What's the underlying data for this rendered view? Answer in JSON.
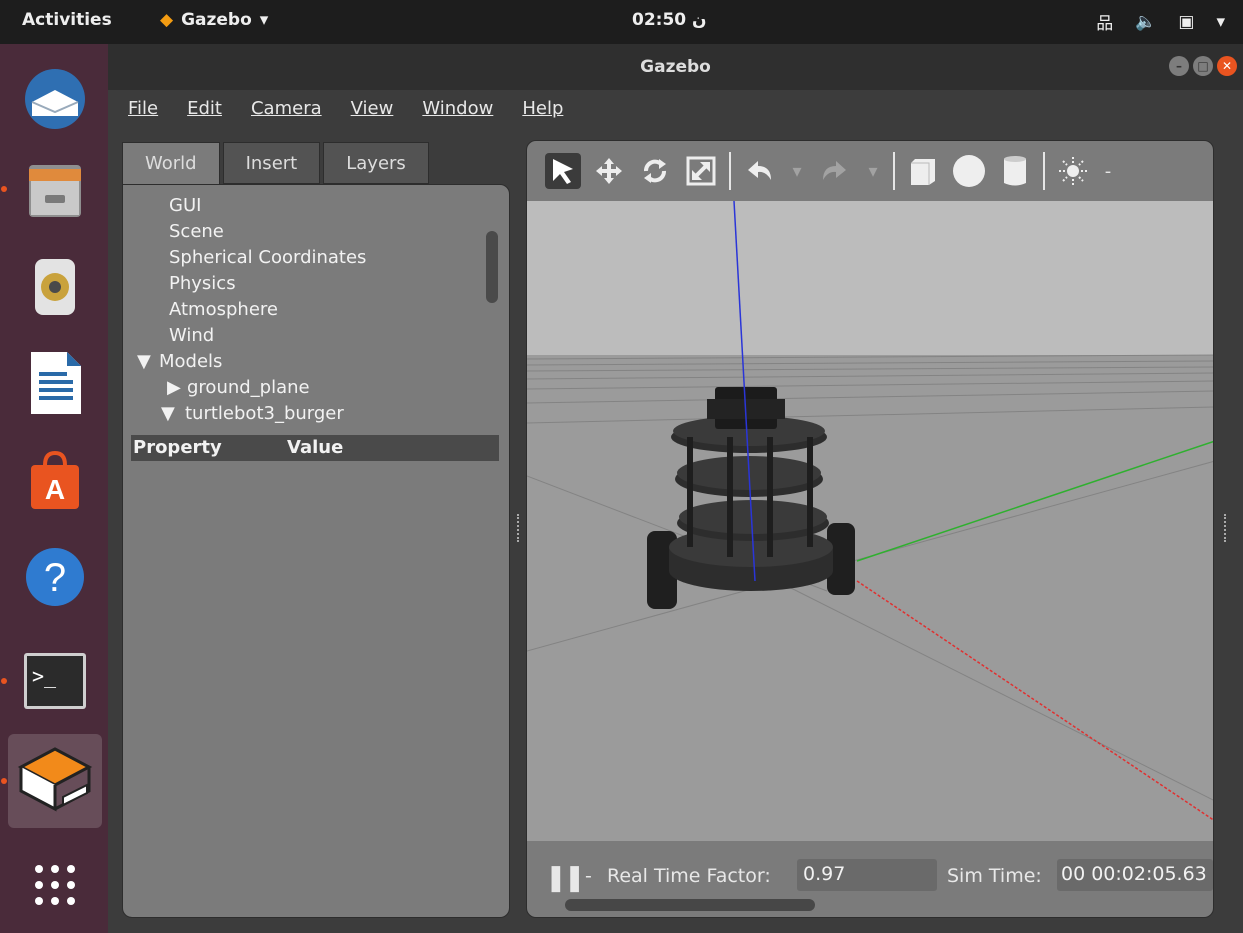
{
  "topbar": {
    "activities": "Activities",
    "app_name": "Gazebo",
    "clock": "02:50 ن"
  },
  "window": {
    "title": "Gazebo"
  },
  "menu": [
    "File",
    "Edit",
    "Camera",
    "View",
    "Window",
    "Help"
  ],
  "left_panel": {
    "tabs": [
      "World",
      "Insert",
      "Layers"
    ],
    "active_tab": "World",
    "tree": [
      {
        "label": "GUI",
        "level": 0
      },
      {
        "label": "Scene",
        "level": 0
      },
      {
        "label": "Spherical Coordinates",
        "level": 0
      },
      {
        "label": "Physics",
        "level": 0
      },
      {
        "label": "Atmosphere",
        "level": 0
      },
      {
        "label": "Wind",
        "level": 0
      },
      {
        "label": "Models",
        "level": 1,
        "expanded": true
      },
      {
        "label": "ground_plane",
        "level": 2,
        "expanded": false
      },
      {
        "label": "turtlebot3_burger",
        "level": 2,
        "expanded": true
      }
    ],
    "property_header": {
      "property": "Property",
      "value": "Value"
    }
  },
  "bottom_bar": {
    "rtf_label": "Real Time Factor:",
    "rtf_value": "0.97",
    "sim_label": "Sim Time:",
    "sim_value": "00 00:02:05.63"
  },
  "colors": {
    "accent": "#e95420",
    "dock_bg": "#4a2b3a",
    "panel_bg": "#7b7b7b",
    "sky": "#bcbcbc",
    "ground": "#9b9b9b"
  },
  "icons": {
    "dock": [
      "thunderbird-icon",
      "files-icon",
      "rhythmbox-icon",
      "libreoffice-writer-icon",
      "ubuntu-software-icon",
      "help-icon",
      "terminal-icon",
      "gazebo-icon",
      "show-apps-icon"
    ],
    "toolbar": [
      "select-mode-icon",
      "translate-mode-icon",
      "rotate-mode-icon",
      "scale-mode-icon",
      "undo-icon",
      "redo-icon",
      "box-icon",
      "sphere-icon",
      "cylinder-icon",
      "light-icon"
    ]
  }
}
